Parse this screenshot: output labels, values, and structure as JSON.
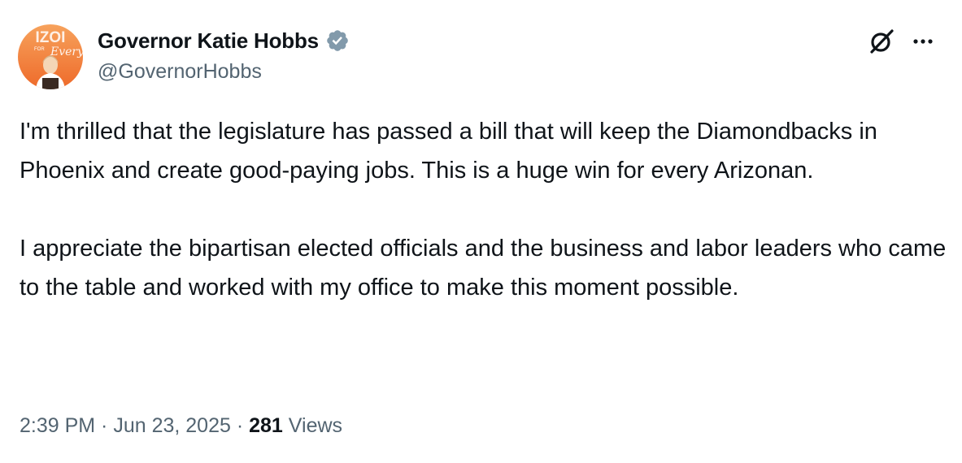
{
  "author": {
    "display_name": "Governor Katie Hobbs",
    "handle": "@GovernorHobbs",
    "verified_badge_color": "#829aab",
    "avatar_logo_text": "IZOI",
    "avatar_sub_text": "FOR",
    "avatar_script_text": "Every"
  },
  "toolbar": {
    "grok_icon": "grok-icon",
    "more_icon": "more-icon"
  },
  "tweet": {
    "paragraph_1": "I'm thrilled that the legislature has passed a bill that will keep the Diamondbacks in Phoenix and create good-paying jobs. This is a huge win for every Arizonan.",
    "paragraph_2": "I appreciate the bipartisan elected officials and the business and labor leaders who came to the table and worked with my office to make this moment possible."
  },
  "meta": {
    "time": "2:39 PM",
    "separator": " · ",
    "date": "Jun 23, 2025",
    "views_count": "281",
    "views_label": " Views"
  },
  "colors": {
    "text_primary": "#0f1419",
    "text_secondary": "#536471",
    "avatar_orange": "#f0762c"
  }
}
